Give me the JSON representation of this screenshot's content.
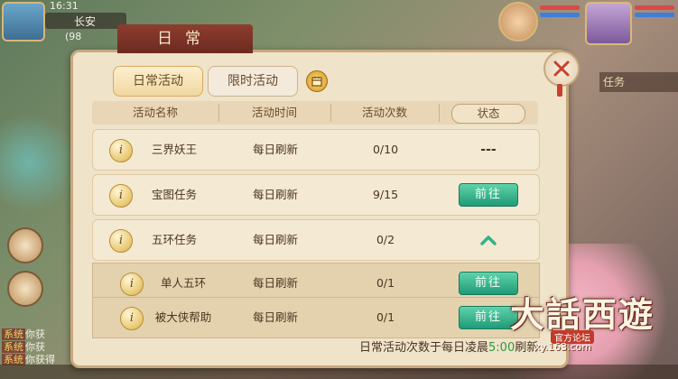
{
  "status_bar": {
    "time": "16:31"
  },
  "location": {
    "name": "长安",
    "coord": "(98"
  },
  "chat": [
    {
      "tag": "系统",
      "text": "你获"
    },
    {
      "tag": "系统",
      "text": "你获"
    },
    {
      "tag": "系统",
      "text": "你获得"
    }
  ],
  "right_panel": {
    "task_label": "任务"
  },
  "panel": {
    "title": "日常",
    "tabs": [
      {
        "label": "日常活动",
        "active": true
      },
      {
        "label": "限时活动",
        "active": false
      }
    ],
    "columns": [
      "活动名称",
      "活动时间",
      "活动次数",
      "状态"
    ],
    "rows": [
      {
        "name": "三界妖王",
        "time": "每日刷新",
        "count": "0/10",
        "status": "---"
      },
      {
        "name": "宝图任务",
        "time": "每日刷新",
        "count": "9/15",
        "status": "前往"
      },
      {
        "name": "五环任务",
        "time": "每日刷新",
        "count": "0/2",
        "status": "expand"
      },
      {
        "name": "单人五环",
        "time": "每日刷新",
        "count": "0/1",
        "status": "前往",
        "sub": true
      },
      {
        "name": "被大侠帮助",
        "time": "每日刷新",
        "count": "0/1",
        "status": "前往",
        "sub": true
      }
    ],
    "info_icon_glyph": "i",
    "footer": {
      "prefix": "日常活动次数于每日凌晨",
      "time": "5:00",
      "suffix": "刷新"
    }
  },
  "watermark": {
    "logo": "大話西遊",
    "subtitle": "官方论坛",
    "url": "xy.163.com"
  },
  "colors": {
    "accent_green": "#1f9a78",
    "title_red": "#8d3d2e",
    "panel_bg": "#efe3c9"
  }
}
